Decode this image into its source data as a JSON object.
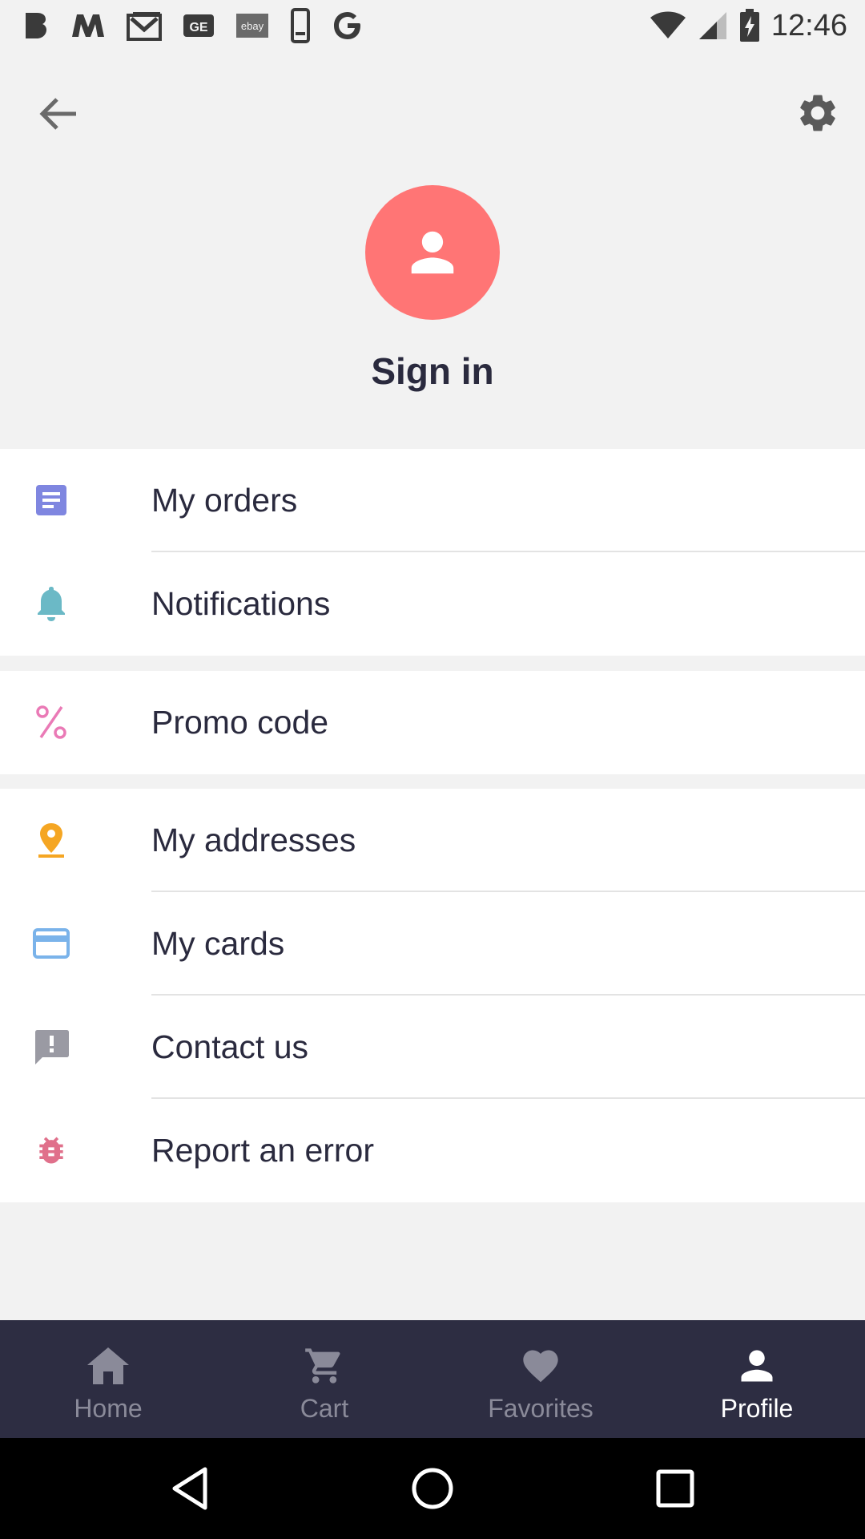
{
  "status_bar": {
    "time": "12:46",
    "left_icons": [
      "b-app-icon",
      "m-app-icon",
      "gmail-icon",
      "ge-app-icon",
      "ebay-icon",
      "phone-device-icon",
      "google-icon"
    ],
    "right_icons": [
      "wifi-icon",
      "signal-icon",
      "battery-charging-icon"
    ],
    "ebay_text": "ebay",
    "ge_text": "GE"
  },
  "header": {
    "back_icon": "arrow-left-icon",
    "settings_icon": "gear-icon",
    "avatar_icon": "person-icon",
    "sign_in_label": "Sign in",
    "avatar_color": "#ff7575"
  },
  "menu": {
    "group1": [
      {
        "label": "My orders",
        "icon": "document-icon",
        "color": "#7f86e0"
      },
      {
        "label": "Notifications",
        "icon": "bell-icon",
        "color": "#6bb9c6"
      }
    ],
    "group2": [
      {
        "label": "Promo code",
        "icon": "percent-icon",
        "color": "#ea7ab6"
      }
    ],
    "group3": [
      {
        "label": "My addresses",
        "icon": "location-pin-icon",
        "color": "#f5a623"
      },
      {
        "label": "My cards",
        "icon": "credit-card-icon",
        "color": "#7ab3ea"
      },
      {
        "label": "Contact us",
        "icon": "feedback-icon",
        "color": "#9a9aa3"
      },
      {
        "label": "Report an error",
        "icon": "bug-icon",
        "color": "#e0708b"
      }
    ]
  },
  "bottom_nav": {
    "items": [
      {
        "label": "Home",
        "icon": "home-icon"
      },
      {
        "label": "Cart",
        "icon": "cart-icon"
      },
      {
        "label": "Favorites",
        "icon": "heart-icon"
      },
      {
        "label": "Profile",
        "icon": "profile-icon"
      }
    ],
    "active": "Profile",
    "background": "#2d2d42"
  },
  "system_nav": {
    "icons": [
      "nav-back-icon",
      "nav-home-icon",
      "nav-recents-icon"
    ]
  }
}
